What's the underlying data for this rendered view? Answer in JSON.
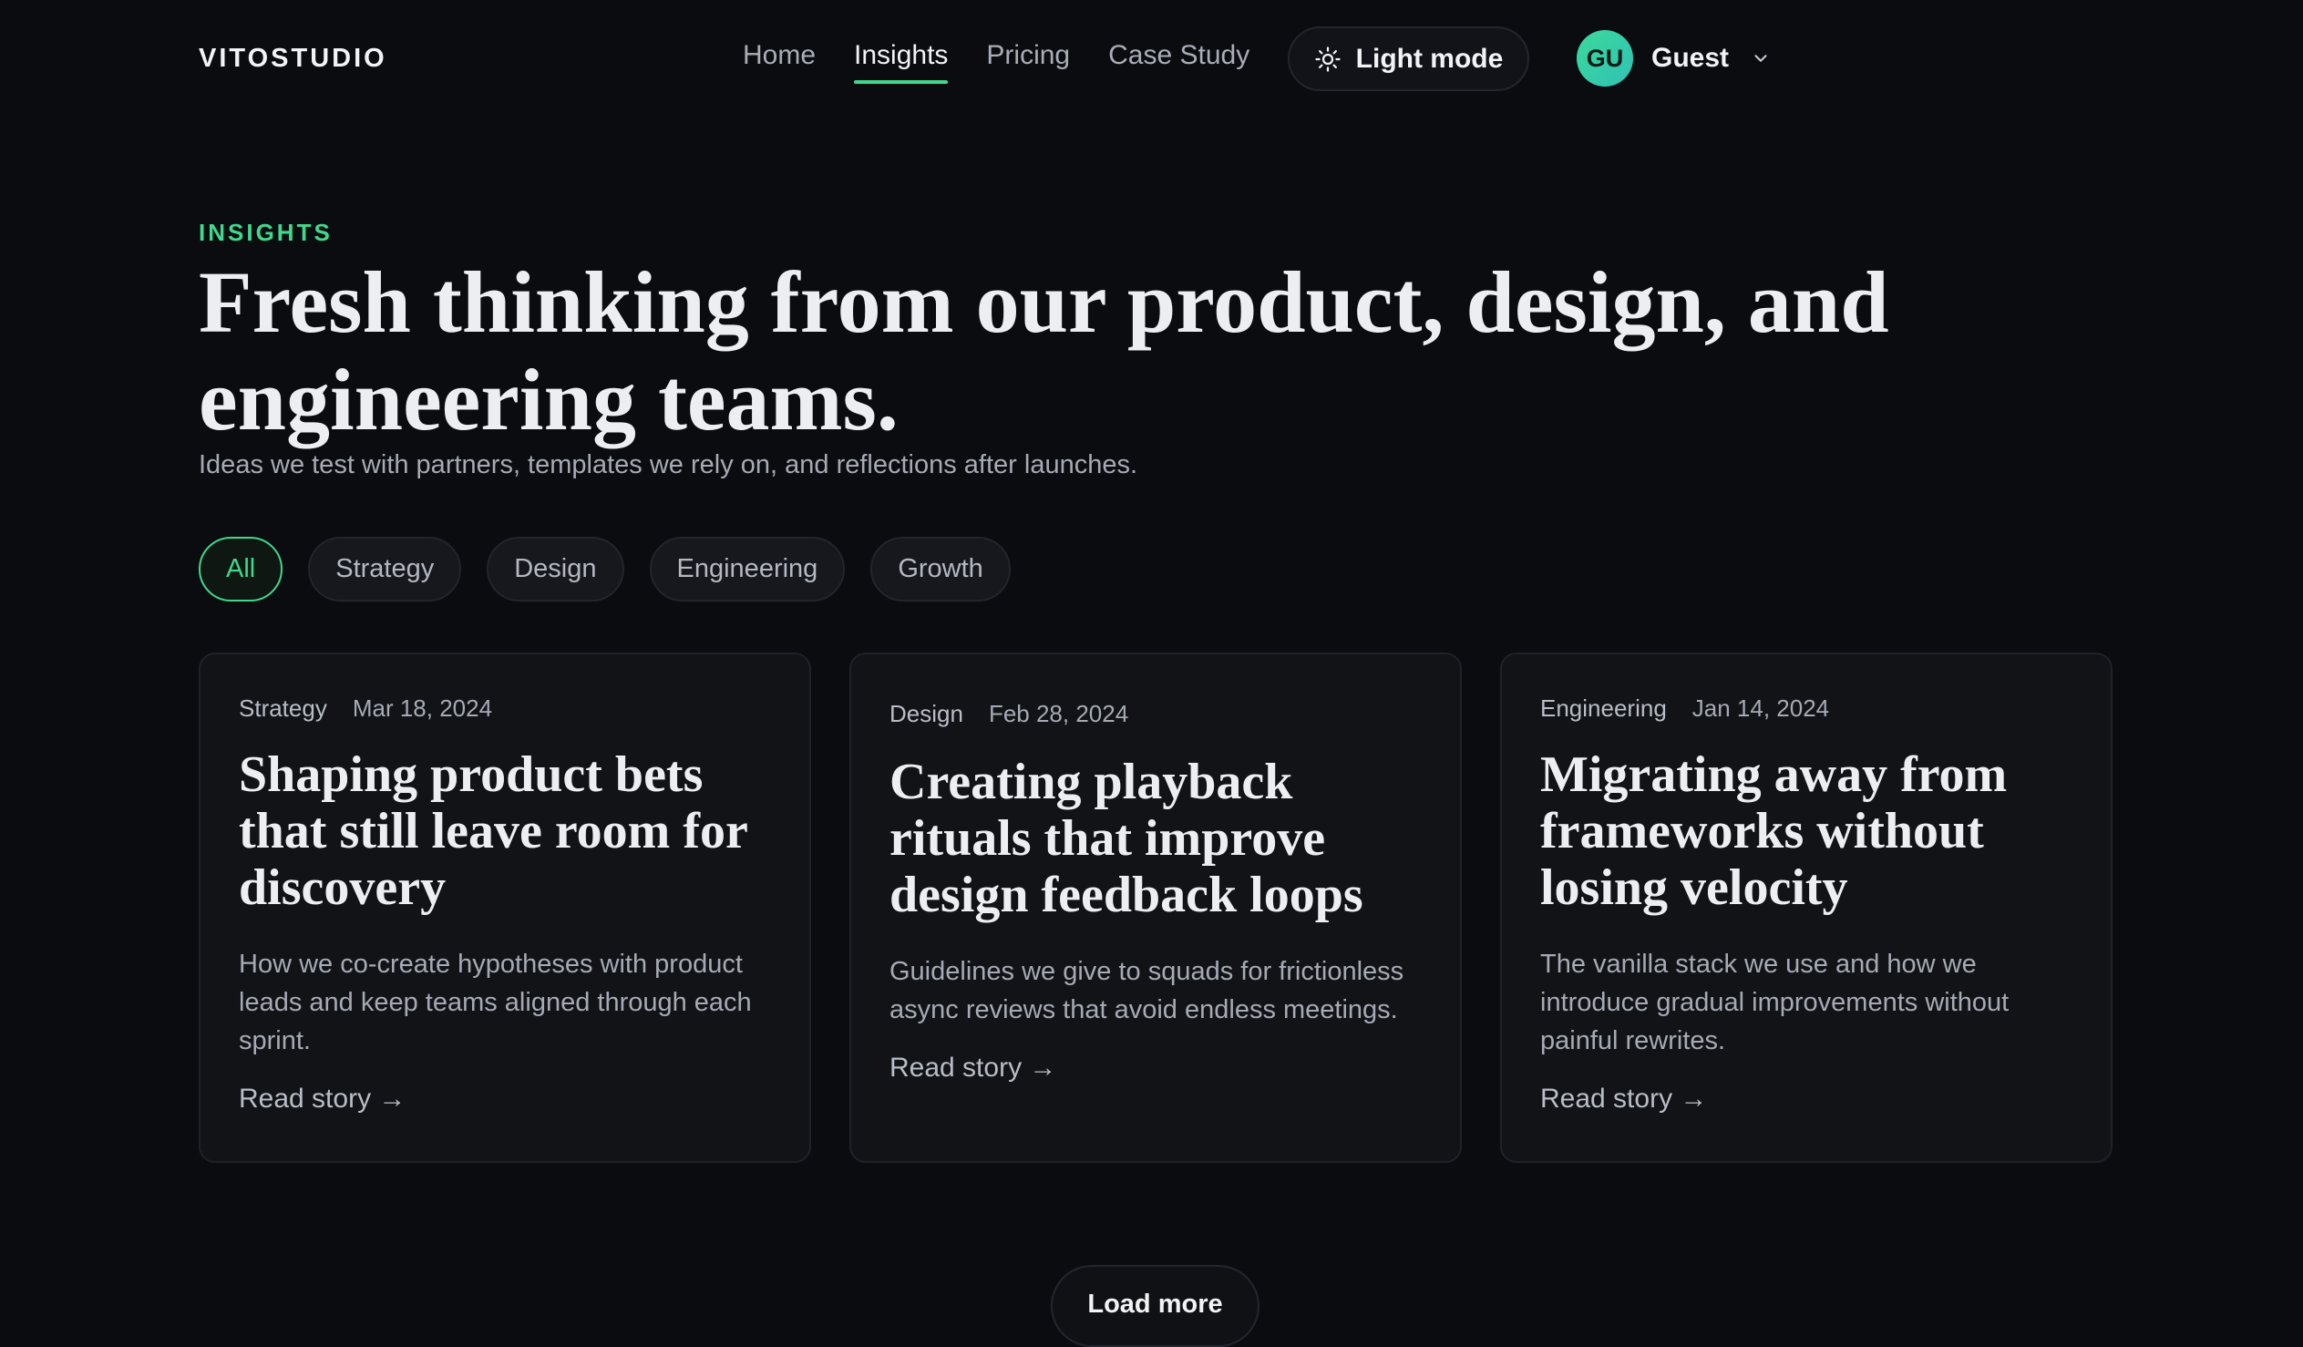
{
  "header": {
    "brand": "VITOSTUDIO",
    "nav": [
      {
        "label": "Home"
      },
      {
        "label": "Insights",
        "active": true
      },
      {
        "label": "Pricing"
      },
      {
        "label": "Case Study"
      }
    ],
    "mode_toggle": {
      "label": "Light mode",
      "icon": "sun-icon"
    },
    "user": {
      "initials": "GU",
      "name": "Guest",
      "icon": "chevron-down-icon"
    }
  },
  "hero": {
    "eyebrow": "INSIGHTS",
    "title": "Fresh thinking from our product, design, and engineering teams.",
    "subtitle": "Ideas we test with partners, templates we rely on, and reflections after launches."
  },
  "filters": [
    {
      "label": "All",
      "active": true
    },
    {
      "label": "Strategy"
    },
    {
      "label": "Design"
    },
    {
      "label": "Engineering"
    },
    {
      "label": "Growth"
    }
  ],
  "cards": [
    {
      "category": "Strategy",
      "date": "Mar 18, 2024",
      "title": "Shaping product bets that still leave room for discovery",
      "excerpt": "How we co-create hypotheses with product leads and keep teams aligned through each sprint.",
      "link": "Read story →"
    },
    {
      "category": "Design",
      "date": "Feb 28, 2024",
      "title": "Creating playback rituals that improve design feedback loops",
      "excerpt": "Guidelines we give to squads for frictionless async reviews that avoid endless meetings.",
      "link": "Read story →"
    },
    {
      "category": "Engineering",
      "date": "Jan 14, 2024",
      "title": "Migrating away from frameworks without losing velocity",
      "excerpt": "The vanilla stack we use and how we introduce gradual improvements without painful rewrites.",
      "link": "Read story →"
    }
  ],
  "load_more": "Load more",
  "colors": {
    "background": "#0b0c10",
    "accent": "#3ed98b",
    "card": "#111317"
  }
}
